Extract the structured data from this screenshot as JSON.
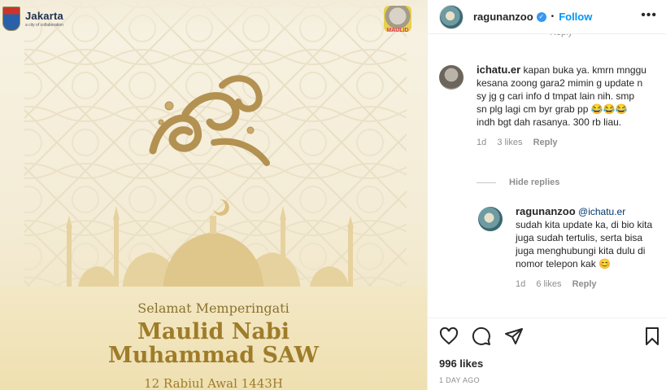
{
  "post_image": {
    "brand": {
      "jakarta_word": "Jakarta",
      "jakarta_tagline": "a city of collaboration",
      "event_logo_label": "MAULID"
    },
    "greeting_line": "Selamat Memperingati",
    "title_line_1": "Maulid Nabi",
    "title_line_2": "Muhammad SAW",
    "date_line": "12 Rabiul Awal 1443H",
    "colors": {
      "gold": "#9e7c2a",
      "cream": "#f7f2e3"
    }
  },
  "post_header": {
    "username": "ragunanzoo",
    "verified": true,
    "separator": "•",
    "follow_label": "Follow",
    "more_label": "•••"
  },
  "comments": [
    {
      "username": "ichatu.er",
      "text": "kapan buka ya. kmrn mnggu kesana zoong gara2 mimin g update n sy jg g cari info d tmpat lain nih. smp sn plg lagi cm byr grab pp 😂😂😂 indh bgt dah rasanya. 300 rb liau.",
      "time": "1d",
      "likes": "3 likes",
      "reply_label": "Reply"
    }
  ],
  "hide_replies_label": "Hide replies",
  "reply": {
    "username": "ragunanzoo",
    "mention": "@ichatu.er",
    "text": "sudah kita update ka, di bio kita juga sudah tertulis, serta bisa juga menghubungi kita dulu di nomor telepon kak 😊",
    "time": "1d",
    "likes": "6 likes",
    "reply_label": "Reply"
  },
  "actions": {
    "icons": [
      "heart-icon",
      "comment-icon",
      "share-icon",
      "bookmark-icon"
    ],
    "likes_count": "996 likes",
    "post_time": "1 DAY AGO"
  }
}
